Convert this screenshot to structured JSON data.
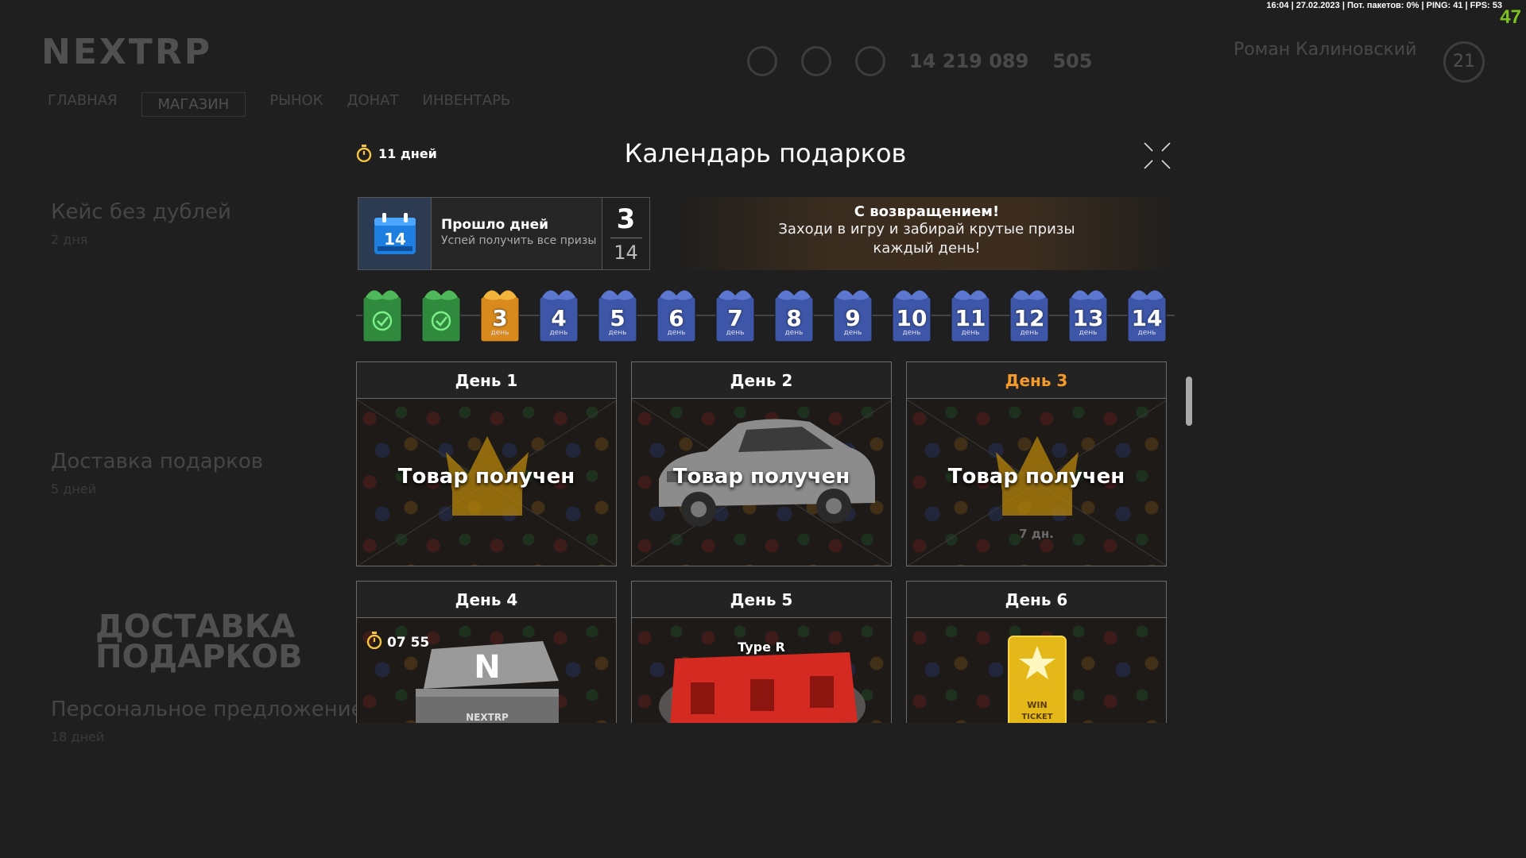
{
  "status_bar": {
    "text": "16:04 | 27.02.2023 | Пот. пакетов: 0% | PING: 41 | FPS: 53",
    "fps_overlay": "47"
  },
  "background": {
    "logo": "NEXTRP",
    "menu_items": [
      "ГЛАВНАЯ",
      "МАГАЗИН",
      "РЫНОК",
      "ДОНАТ",
      "ИНВЕНТАРЬ"
    ],
    "hud_money": "14 219 089",
    "hud_coins": "505",
    "user_name": "Роман Калиновский",
    "user_level": "21",
    "side_items": [
      {
        "title": "Кейс без дублей",
        "sub": "2 дня"
      },
      {
        "title": "Доставка подарков",
        "sub": "5 дней"
      },
      {
        "title": "Персональное предложение",
        "sub": "18 дней"
      }
    ],
    "banner": "ДОСТАВКА ПОДАРКОВ"
  },
  "modal": {
    "timer": "11 дней",
    "title": "Календарь подарков",
    "days_panel": {
      "title": "Прошло дней",
      "subtitle": "Успей получить все призы",
      "current": "3",
      "total": "14",
      "calendar_icon_text": "14"
    },
    "welcome": {
      "title": "С возвращением!",
      "line1": "Заходи в игру и забирай крутые призы",
      "line2": "каждый день!"
    },
    "day_word": "день",
    "gifts": [
      {
        "num": "",
        "state": "claimed",
        "color": "#2f8a3e"
      },
      {
        "num": "",
        "state": "claimed",
        "color": "#2f8a3e"
      },
      {
        "num": "3",
        "state": "current",
        "color": "#d98a1c"
      },
      {
        "num": "4",
        "state": "locked",
        "color": "#3d56a8"
      },
      {
        "num": "5",
        "state": "locked",
        "color": "#3d56a8"
      },
      {
        "num": "6",
        "state": "locked",
        "color": "#3d56a8"
      },
      {
        "num": "7",
        "state": "locked",
        "color": "#3d56a8"
      },
      {
        "num": "8",
        "state": "locked",
        "color": "#3d56a8"
      },
      {
        "num": "9",
        "state": "locked",
        "color": "#3d56a8"
      },
      {
        "num": "10",
        "state": "locked",
        "color": "#3d56a8"
      },
      {
        "num": "11",
        "state": "locked",
        "color": "#3d56a8"
      },
      {
        "num": "12",
        "state": "locked",
        "color": "#3d56a8"
      },
      {
        "num": "13",
        "state": "locked",
        "color": "#3d56a8"
      },
      {
        "num": "14",
        "state": "locked",
        "color": "#3d56a8"
      }
    ],
    "cards": [
      {
        "title": "День 1",
        "status": "Товар получен",
        "prize_icon": "crown-icon"
      },
      {
        "title": "День 2",
        "status": "Товар получен",
        "prize_icon": "car-icon"
      },
      {
        "title": "День 3",
        "status": "Товар получен",
        "expire": "7 дн.",
        "prize_icon": "crown-icon"
      },
      {
        "title": "День 4",
        "timer": "07 55",
        "prize_icon": "nextrp-case-icon"
      },
      {
        "title": "День 5",
        "label": "Type R",
        "prize_icon": "red-case-icon"
      },
      {
        "title": "День 6",
        "ticket_text_1": "WIN",
        "ticket_text_2": "TICKET",
        "prize_icon": "win-ticket-icon"
      }
    ]
  },
  "colors": {
    "accent_orange": "#f39a2a",
    "claimed_green": "#2f8a3e",
    "locked_blue": "#3d56a8",
    "fps_green": "#7dc41f"
  }
}
